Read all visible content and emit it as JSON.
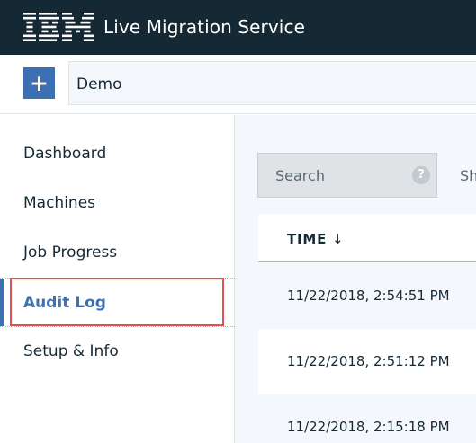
{
  "header": {
    "logo": "IBM",
    "title": "Live Migration Service"
  },
  "toolbar": {
    "add_label": "+",
    "selector_value": "Demo"
  },
  "sidebar": {
    "items": [
      {
        "label": "Dashboard"
      },
      {
        "label": "Machines"
      },
      {
        "label": "Job Progress"
      },
      {
        "label": "Audit Log"
      },
      {
        "label": "Setup & Info"
      }
    ],
    "active": "Audit Log"
  },
  "main": {
    "search_placeholder": "Search",
    "help_icon": "?",
    "show_label": "Sh",
    "table": {
      "column_header": "TIME",
      "sort_indicator": "↓",
      "rows": [
        "11/22/2018, 2:54:51 PM",
        "11/22/2018, 2:51:12 PM",
        "11/22/2018, 2:15:18 PM"
      ]
    }
  },
  "colors": {
    "header_bg": "#152935",
    "accent": "#3d70b2",
    "highlight": "#e05252",
    "content_bg": "#f4f7fb"
  }
}
